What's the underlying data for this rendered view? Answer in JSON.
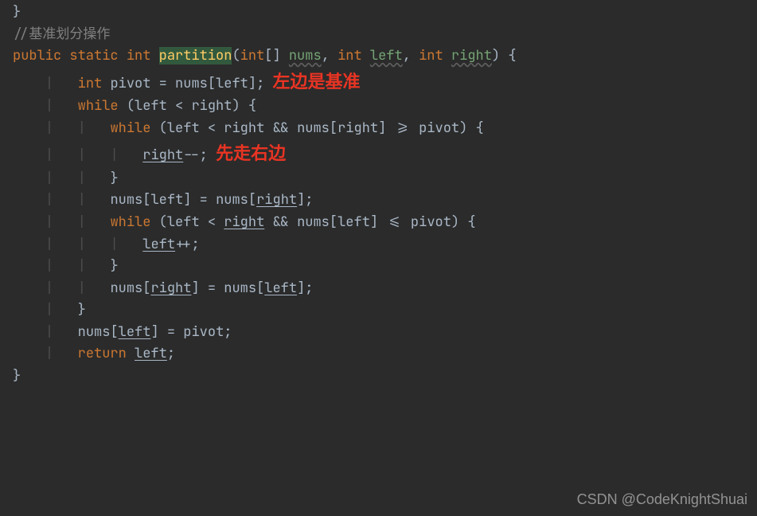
{
  "colors": {
    "background": "#2b2b2b",
    "default": "#a9b7c6",
    "keyword": "#cc7832",
    "methodName": "#ffcc66",
    "param": "#74a374",
    "comment": "#808080",
    "annotation": "#e93423",
    "highlightBg": "#32593d"
  },
  "code": {
    "line0": "}",
    "comment": "//基准划分操作",
    "kw_public": "public",
    "kw_static": "static",
    "kw_int": "int",
    "method": "partition",
    "lpar": "(",
    "brkt_open": "[",
    "brkt_close": "]",
    "rpar": ")",
    "p_nums": "nums",
    "p_left": "left",
    "p_right": "right",
    "comma": ",",
    "lbrace": "{",
    "rbrace": "}",
    "id_pivot": "pivot",
    "id_nums": "nums",
    "id_left": "left",
    "id_right": "right",
    "eq": "=",
    "semi": ";",
    "kw_while": "while",
    "lt": "<",
    "and": "&&",
    "gte": ">=",
    "lte": "<=",
    "dec": "--",
    "inc": "++",
    "kw_return": "return",
    "ann1": "左边是基准",
    "ann2": "先走右边"
  },
  "watermark": "CSDN @CodeKnightShuai"
}
